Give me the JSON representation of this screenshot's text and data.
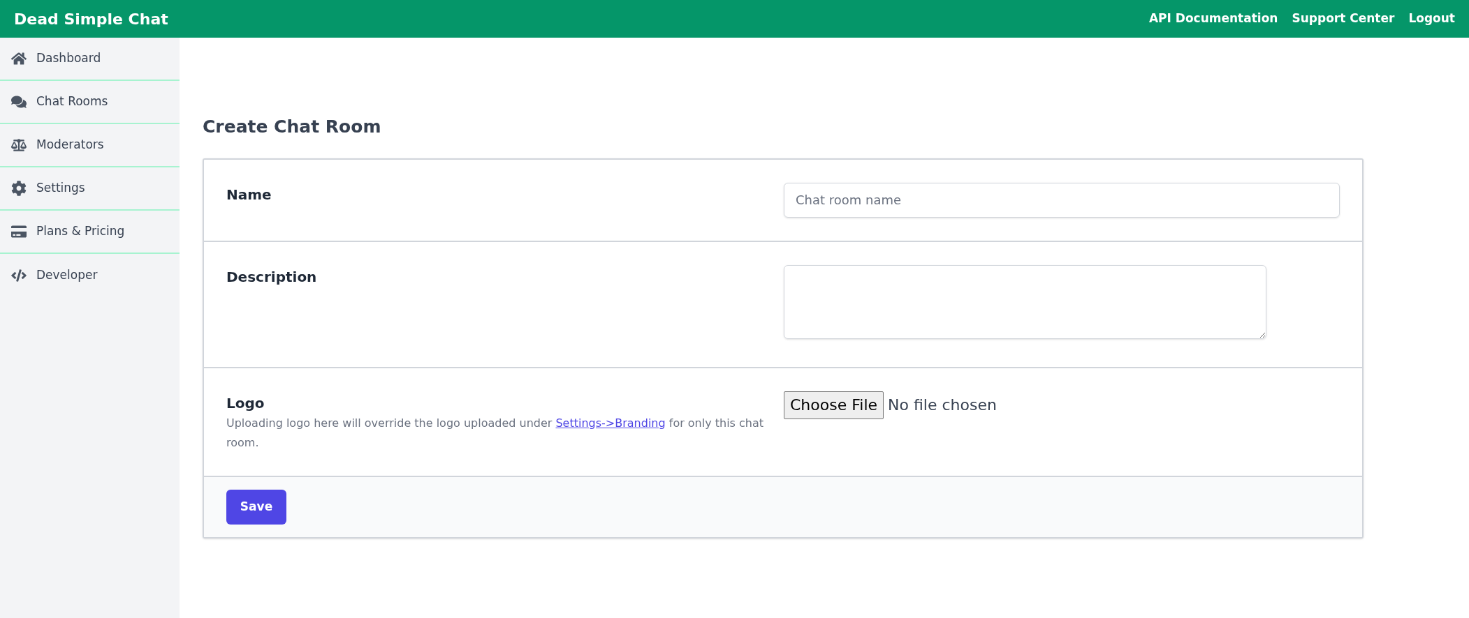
{
  "header": {
    "brand": "Dead Simple Chat",
    "links": [
      "API Documentation",
      "Support Center",
      "Logout"
    ]
  },
  "sidebar": {
    "items": [
      {
        "label": "Dashboard"
      },
      {
        "label": "Chat Rooms"
      },
      {
        "label": "Moderators"
      },
      {
        "label": "Settings"
      },
      {
        "label": "Plans & Pricing"
      },
      {
        "label": "Developer"
      }
    ]
  },
  "page_title": "Create Chat Room",
  "form": {
    "fields": [
      {
        "kind": "text",
        "label": "Name",
        "placeholder": "Chat room name"
      },
      {
        "kind": "textarea",
        "label": "Description"
      },
      {
        "kind": "file",
        "label": "Logo",
        "help_before": "Uploading logo here will override the logo uploaded under ",
        "help_link": "Settings->Branding",
        "help_after": " for only this chat room.",
        "button": "Choose File",
        "status": "No file chosen"
      }
    ],
    "submit": "Save"
  }
}
